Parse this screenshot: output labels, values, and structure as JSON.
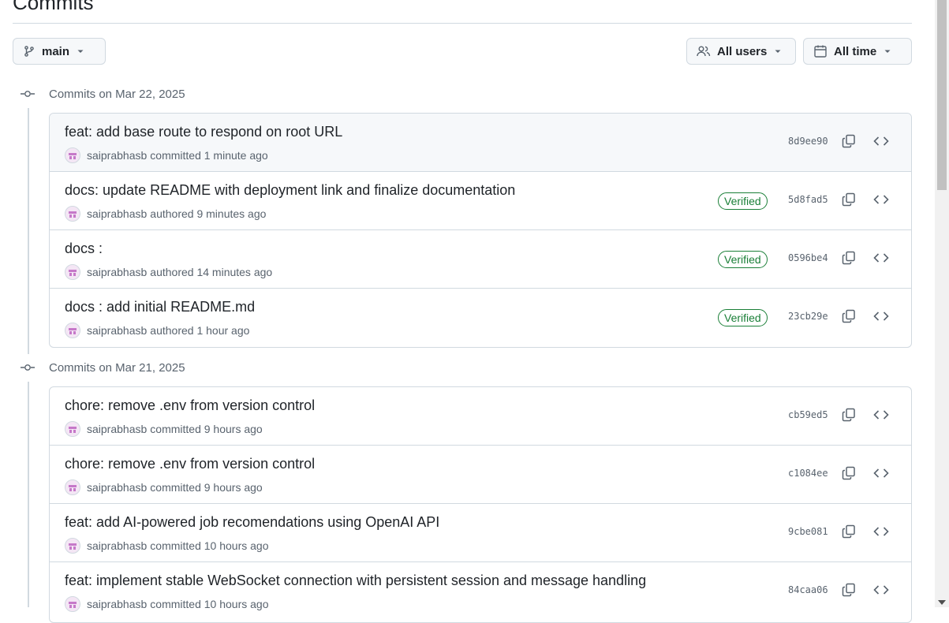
{
  "page": {
    "title": "Commits"
  },
  "filters": {
    "branch": "main",
    "users": "All users",
    "time": "All time"
  },
  "groups": [
    {
      "title": "Commits on Mar 22, 2025",
      "commits": [
        {
          "message": "feat: add base route to respond on root URL",
          "author": "saiprabhasb",
          "action": "committed",
          "time": "1 minute ago",
          "verified": "",
          "sha": "8d9ee90"
        },
        {
          "message": "docs: update README with deployment link and finalize documentation",
          "author": "saiprabhasb",
          "action": "authored",
          "time": "9 minutes ago",
          "verified": "Verified",
          "sha": "5d8fad5"
        },
        {
          "message": "docs :",
          "author": "saiprabhasb",
          "action": "authored",
          "time": "14 minutes ago",
          "verified": "Verified",
          "sha": "0596be4"
        },
        {
          "message": "docs : add initial README.md",
          "author": "saiprabhasb",
          "action": "authored",
          "time": "1 hour ago",
          "verified": "Verified",
          "sha": "23cb29e"
        }
      ]
    },
    {
      "title": "Commits on Mar 21, 2025",
      "commits": [
        {
          "message": "chore: remove .env from version control",
          "author": "saiprabhasb",
          "action": "committed",
          "time": "9 hours ago",
          "verified": "",
          "sha": "cb59ed5"
        },
        {
          "message": "chore: remove .env from version control",
          "author": "saiprabhasb",
          "action": "committed",
          "time": "9 hours ago",
          "verified": "",
          "sha": "c1084ee"
        },
        {
          "message": "feat: add AI-powered job recomendations using OpenAI API",
          "author": "saiprabhasb",
          "action": "committed",
          "time": "10 hours ago",
          "verified": "",
          "sha": "9cbe081"
        },
        {
          "message": "feat: implement stable WebSocket connection with persistent session and message handling",
          "author": "saiprabhasb",
          "action": "committed",
          "time": "10 hours ago",
          "verified": "",
          "sha": "84caa06"
        }
      ]
    }
  ],
  "icons": {
    "branch": "git-branch-icon",
    "users": "people-icon",
    "time": "calendar-icon",
    "node": "git-commit-icon",
    "copy": "copy-icon",
    "browse": "code-icon",
    "caret": "triangle-down-icon"
  },
  "colors": {
    "verified": "#1a7f37",
    "border": "#d1d9e0",
    "muted": "#59636e",
    "highlight_row": "#f6f8fa"
  }
}
